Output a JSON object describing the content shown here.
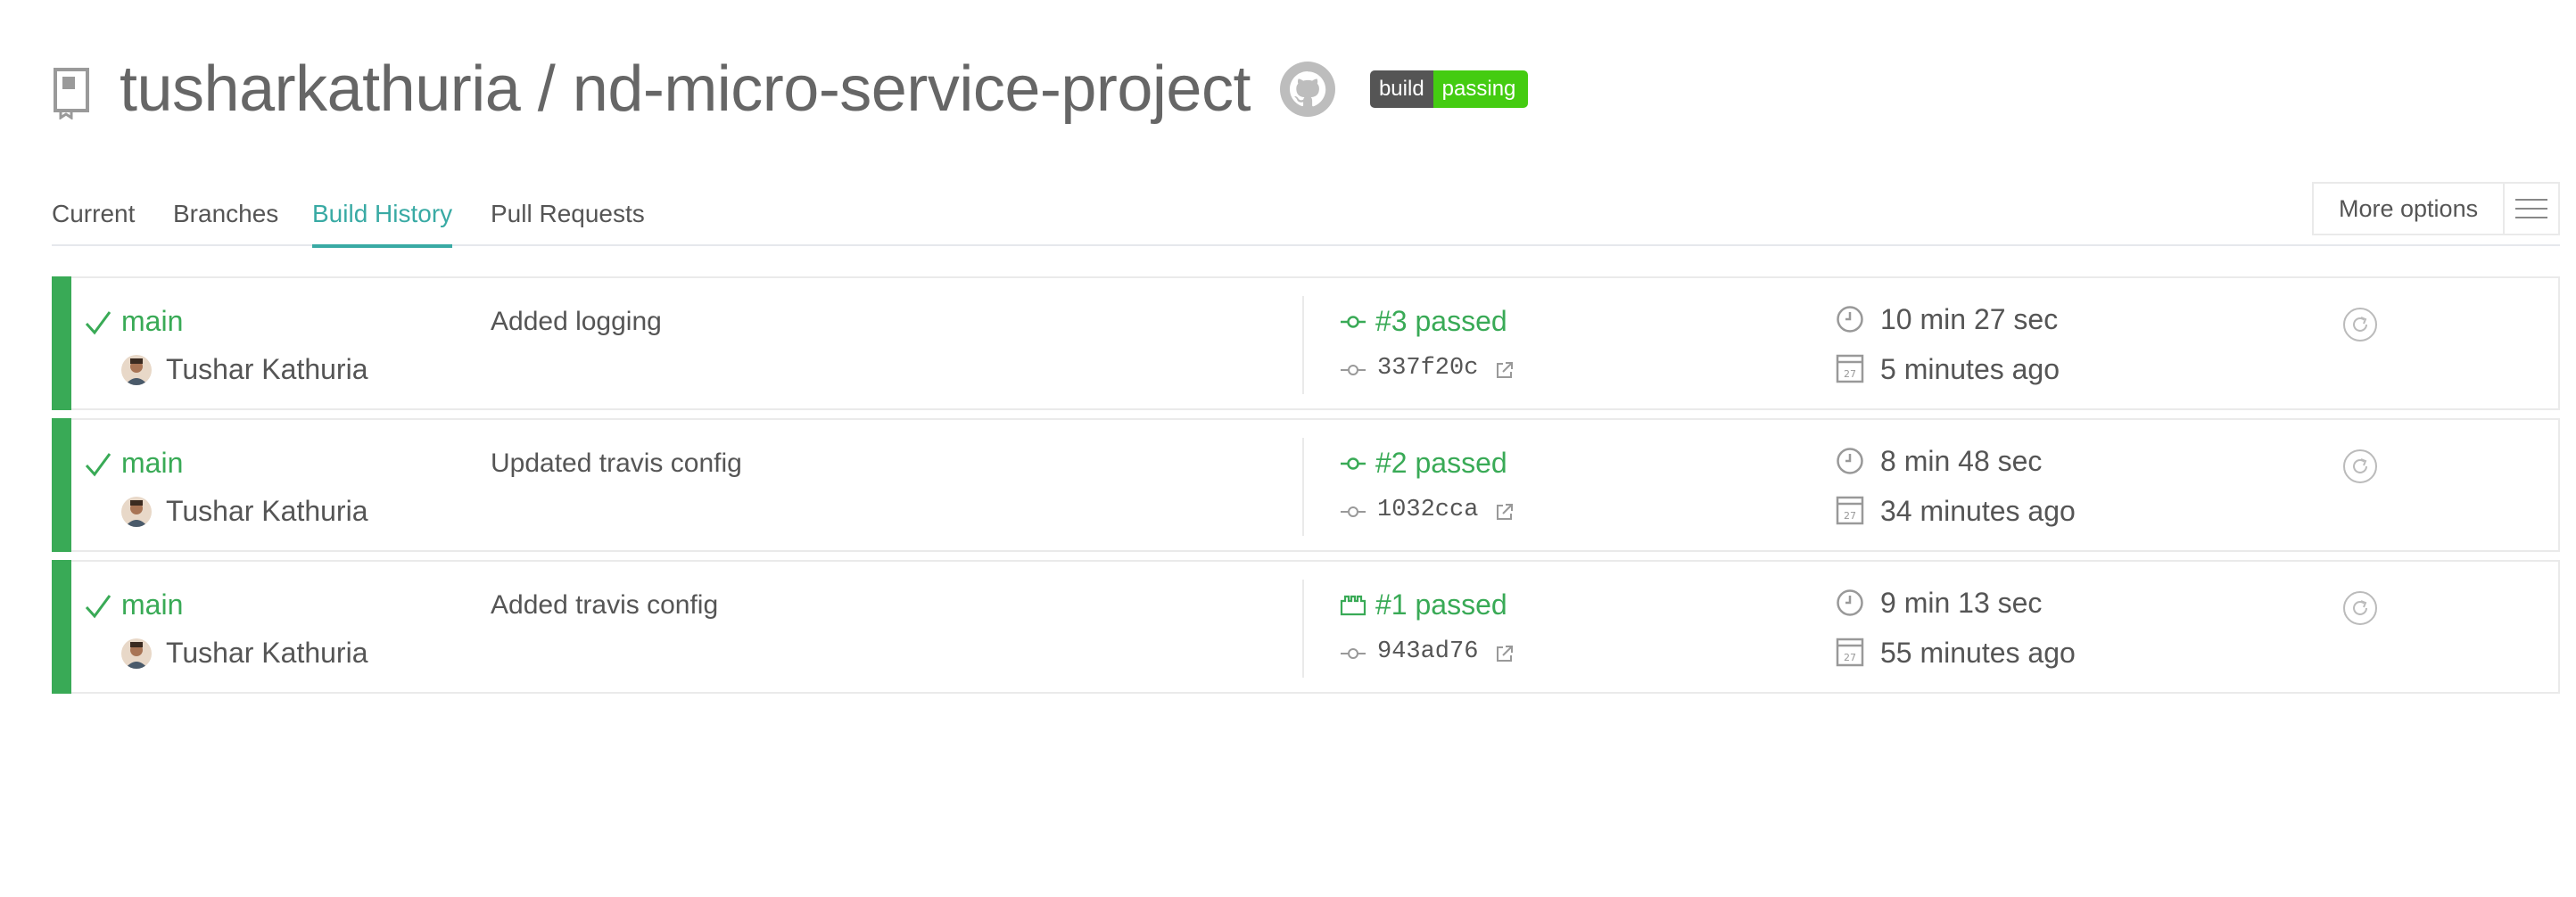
{
  "header": {
    "repo_title": "tusharkathuria / nd-micro-service-project",
    "badge_left": "build",
    "badge_right": "passing",
    "icons": [
      "repo-icon",
      "github-icon"
    ]
  },
  "tabs": [
    {
      "label": "Current",
      "active": false
    },
    {
      "label": "Branches",
      "active": false
    },
    {
      "label": "Build History",
      "active": true
    },
    {
      "label": "Pull Requests",
      "active": false
    }
  ],
  "more_options": {
    "label": "More options",
    "icon": "hamburger-menu-icon"
  },
  "builds": [
    {
      "branch": "main",
      "author": "Tushar Kathuria",
      "message": "Added logging",
      "state": "#3 passed",
      "state_icon": "push-icon",
      "commit": "337f20c",
      "duration": "10 min 27 sec",
      "finished": "5 minutes ago"
    },
    {
      "branch": "main",
      "author": "Tushar Kathuria",
      "message": "Updated travis config",
      "state": "#2 passed",
      "state_icon": "push-icon",
      "commit": "1032cca",
      "duration": "8 min 48 sec",
      "finished": "34 minutes ago"
    },
    {
      "branch": "main",
      "author": "Tushar Kathuria",
      "message": "Added travis config",
      "state": "#1 passed",
      "state_icon": "api-icon",
      "commit": "943ad76",
      "duration": "9 min 13 sec",
      "finished": "55 minutes ago"
    }
  ],
  "colors": {
    "passed": "#39aa56",
    "active_tab": "#39aaa4",
    "badge_left": "#555555",
    "badge_right": "#44cc11"
  }
}
